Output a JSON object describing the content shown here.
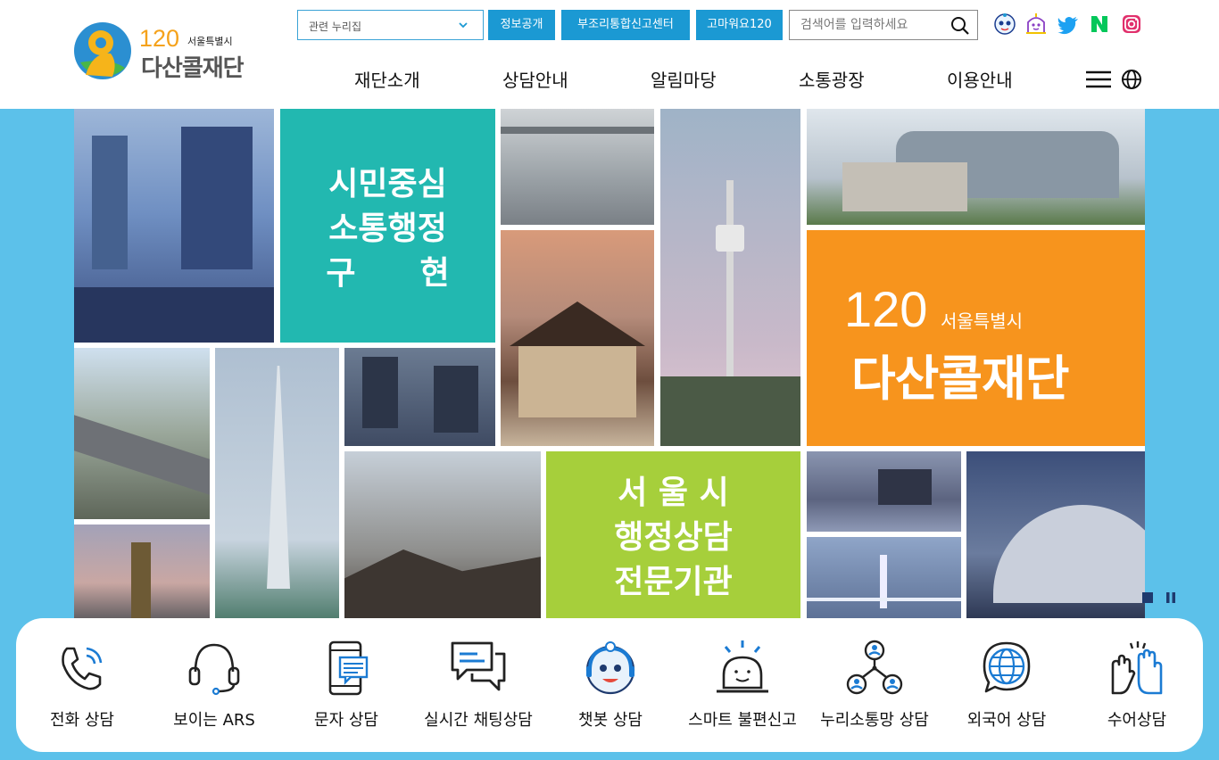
{
  "logo": {
    "number": "120",
    "sub": "서울특별시",
    "name": "다산콜재단"
  },
  "top": {
    "related_select": "관련 누리집",
    "buttons": [
      "정보공개",
      "부조리통합신고센터",
      "고마워요120"
    ],
    "search_placeholder": "검색어를 입력하세요"
  },
  "sns": [
    "chatbot-character-icon",
    "robot-character-icon",
    "twitter-icon",
    "naver-blog-icon",
    "instagram-icon"
  ],
  "nav": [
    "재단소개",
    "상담안내",
    "알림마당",
    "소통광장",
    "이용안내"
  ],
  "hero": {
    "tile1": [
      "시민중심",
      "소통행정",
      "구　　현"
    ],
    "tile2": {
      "num": "120",
      "sub": "서울특별시",
      "name": "다산콜재단"
    },
    "tile3": [
      "서 울 시",
      "행정상담",
      "전문기관"
    ]
  },
  "quick_menu": [
    {
      "label": "전화 상담",
      "icon": "phone-icon"
    },
    {
      "label": "보이는 ARS",
      "icon": "headset-icon"
    },
    {
      "label": "문자 상담",
      "icon": "mobile-message-icon"
    },
    {
      "label": "실시간 채팅상담",
      "icon": "chat-bubbles-icon"
    },
    {
      "label": "챗봇 상담",
      "icon": "chatbot-icon"
    },
    {
      "label": "스마트 불편신고",
      "icon": "alarm-bell-icon"
    },
    {
      "label": "누리소통망 상담",
      "icon": "network-users-icon"
    },
    {
      "label": "외국어 상담",
      "icon": "globe-speech-icon"
    },
    {
      "label": "수어상담",
      "icon": "sign-language-icon"
    }
  ],
  "colors": {
    "accent": "#1b99d3",
    "hero_bg": "#5cc1ea",
    "teal": "#22b8b0",
    "orange": "#f7941d",
    "lime": "#a6cf3b"
  }
}
